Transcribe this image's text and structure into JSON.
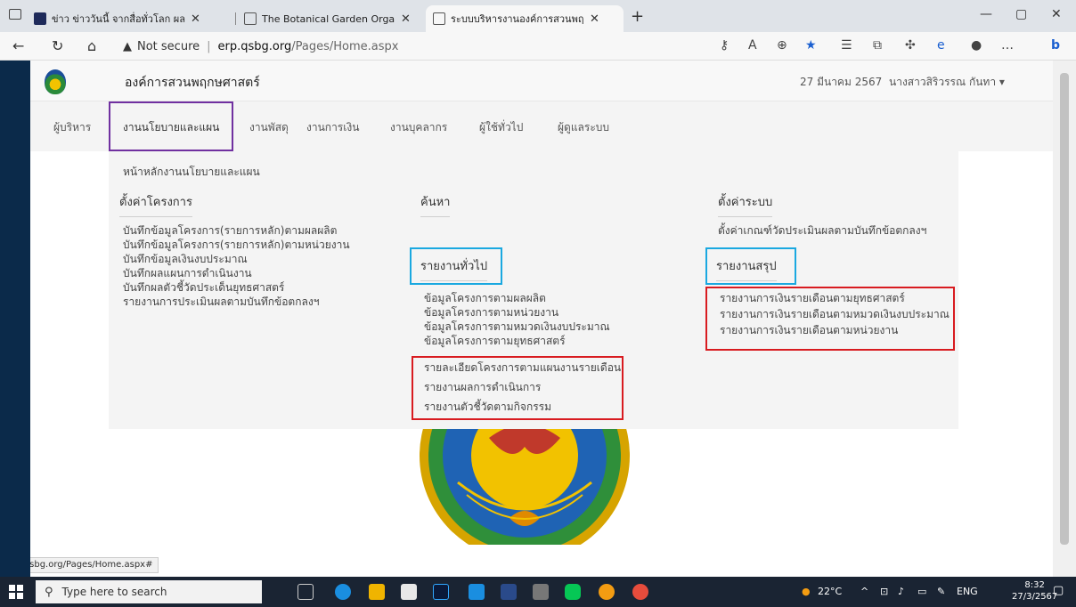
{
  "browser": {
    "tabs": [
      {
        "title": "ข่าว ข่าววันนี้ จากสื่อทั่วโลก ผลบอลโลก"
      },
      {
        "title": "The Botanical Garden Organization"
      },
      {
        "title": "ระบบบริหารงานองค์การสวนพฤกษศาสตร์"
      }
    ],
    "new_tab": "+",
    "url_warning": "Not secure",
    "url_host": "erp.qsbg.org",
    "url_path": "/Pages/Home.aspx"
  },
  "header": {
    "org_name": "องค์การสวนพฤกษศาสตร์",
    "date": "27 มีนาคม 2567",
    "user": "นางสาวสิริวรรณ กันทา ▾"
  },
  "menu": {
    "items": [
      "ผู้บริหาร",
      "งานนโยบายและแผน",
      "งานพัสดุ",
      "งานการเงิน",
      "งานบุคลากร",
      "ผู้ใช้ทั่วไป",
      "ผู้ดูแลระบบ"
    ],
    "active": "งานนโยบายและแผน"
  },
  "content": {
    "title": "หน้าหลักงานนโยบายและแผน",
    "setup": {
      "heading": "ตั้งค่าโครงการ",
      "links": [
        "บันทึกข้อมูลโครงการ(รายการหลัก)ตามผลผลิต",
        "บันทึกข้อมูลโครงการ(รายการหลัก)ตามหน่วยงาน",
        "บันทึกข้อมูลเงินงบประมาณ",
        "บันทึกผลแผนการดำเนินงาน",
        "บันทึกผลตัวชี้วัดประเด็นยุทธศาสตร์",
        "รายงานการประเมินผลตามบันทึกข้อตกลงฯ"
      ]
    },
    "search": {
      "heading": "ค้นหา"
    },
    "general": {
      "heading": "รายงานทั่วไป",
      "links": [
        "ข้อมูลโครงการตามผลผลิต",
        "ข้อมูลโครงการตามหน่วยงาน",
        "ข้อมูลโครงการตามหมวดเงินงบประมาณ",
        "ข้อมูลโครงการตามยุทธศาสตร์",
        "รายละเอียดโครงการตามแผนงานรายเดือน",
        "รายงานผลการดำเนินการ",
        "รายงานตัวชี้วัดตามกิจกรรม"
      ]
    },
    "system": {
      "heading": "ตั้งค่าระบบ",
      "links": [
        "ตั้งค่าเกณฑ์วัดประเมินผลตามบันทึกข้อตกลงฯ"
      ]
    },
    "summary": {
      "heading": "รายงานสรุป",
      "links": [
        "รายงานการเงินรายเดือนตามยุทธศาสตร์",
        "รายงานการเงินรายเดือนตามหมวดเงินงบประมาณ",
        "รายงานการเงินรายเดือนตามหน่วยงาน"
      ]
    }
  },
  "status_bar_url": "erp.qsbg.org/Pages/Home.aspx#",
  "taskbar": {
    "search_placeholder": "Type here to search",
    "weather": "22°C",
    "lang": "ENG",
    "time": "8:32",
    "date": "27/3/2567"
  },
  "colors": {
    "menu_highlight": "#7030a0",
    "blue_highlight": "#1aa8e0",
    "red_highlight": "#d81b20"
  }
}
